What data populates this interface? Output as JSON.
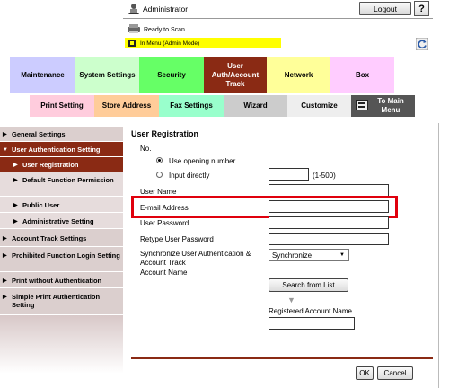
{
  "header": {
    "admin_label": "Administrator",
    "logout_label": "Logout",
    "help_label": "?",
    "status_text": "Ready to Scan",
    "mode_text": "In Menu (Admin Mode)"
  },
  "tabs_row1": [
    {
      "label": "Maintenance",
      "color": "#ccccff"
    },
    {
      "label": "System Settings",
      "color": "#ccffcc"
    },
    {
      "label": "Security",
      "color": "#66ff66"
    },
    {
      "label": "User Auth/Account Track",
      "color": "#8a2a14"
    },
    {
      "label": "Network",
      "color": "#ffff99"
    },
    {
      "label": "Box",
      "color": "#ffccff"
    }
  ],
  "tabs_row2": [
    {
      "label": "Print Setting",
      "color": "#ffccdd"
    },
    {
      "label": "Store Address",
      "color": "#ffcc99"
    },
    {
      "label": "Fax Settings",
      "color": "#99ffcc"
    },
    {
      "label": "Wizard",
      "color": "#cccccc"
    },
    {
      "label": "Customize",
      "color": "#eeeeee"
    },
    {
      "label": "To Main Menu",
      "color": "#555555"
    }
  ],
  "sidebar": {
    "items": [
      {
        "label": "General Settings"
      },
      {
        "label": "User Authentication Setting"
      },
      {
        "label": "User Registration"
      },
      {
        "label": "Default Function Permission"
      },
      {
        "label": "Public User"
      },
      {
        "label": "Administrative Setting"
      },
      {
        "label": "Account Track Settings"
      },
      {
        "label": "Prohibited Function Login Setting"
      },
      {
        "label": "Print without Authentication"
      },
      {
        "label": "Simple Print Authentication Setting"
      }
    ]
  },
  "form": {
    "title": "User Registration",
    "no_label": "No.",
    "radio_opening": "Use opening number",
    "radio_direct": "Input directly",
    "range_hint": "(1-500)",
    "user_name_label": "User Name",
    "email_label": "E-mail Address",
    "password_label": "User Password",
    "retype_label": "Retype User Password",
    "sync_label": "Synchronize User Authentication & Account Track",
    "sync_value": "Synchronize",
    "account_name_label": "Account Name",
    "search_button": "Search from List",
    "registered_label": "Registered Account Name",
    "ok_label": "OK",
    "cancel_label": "Cancel"
  }
}
